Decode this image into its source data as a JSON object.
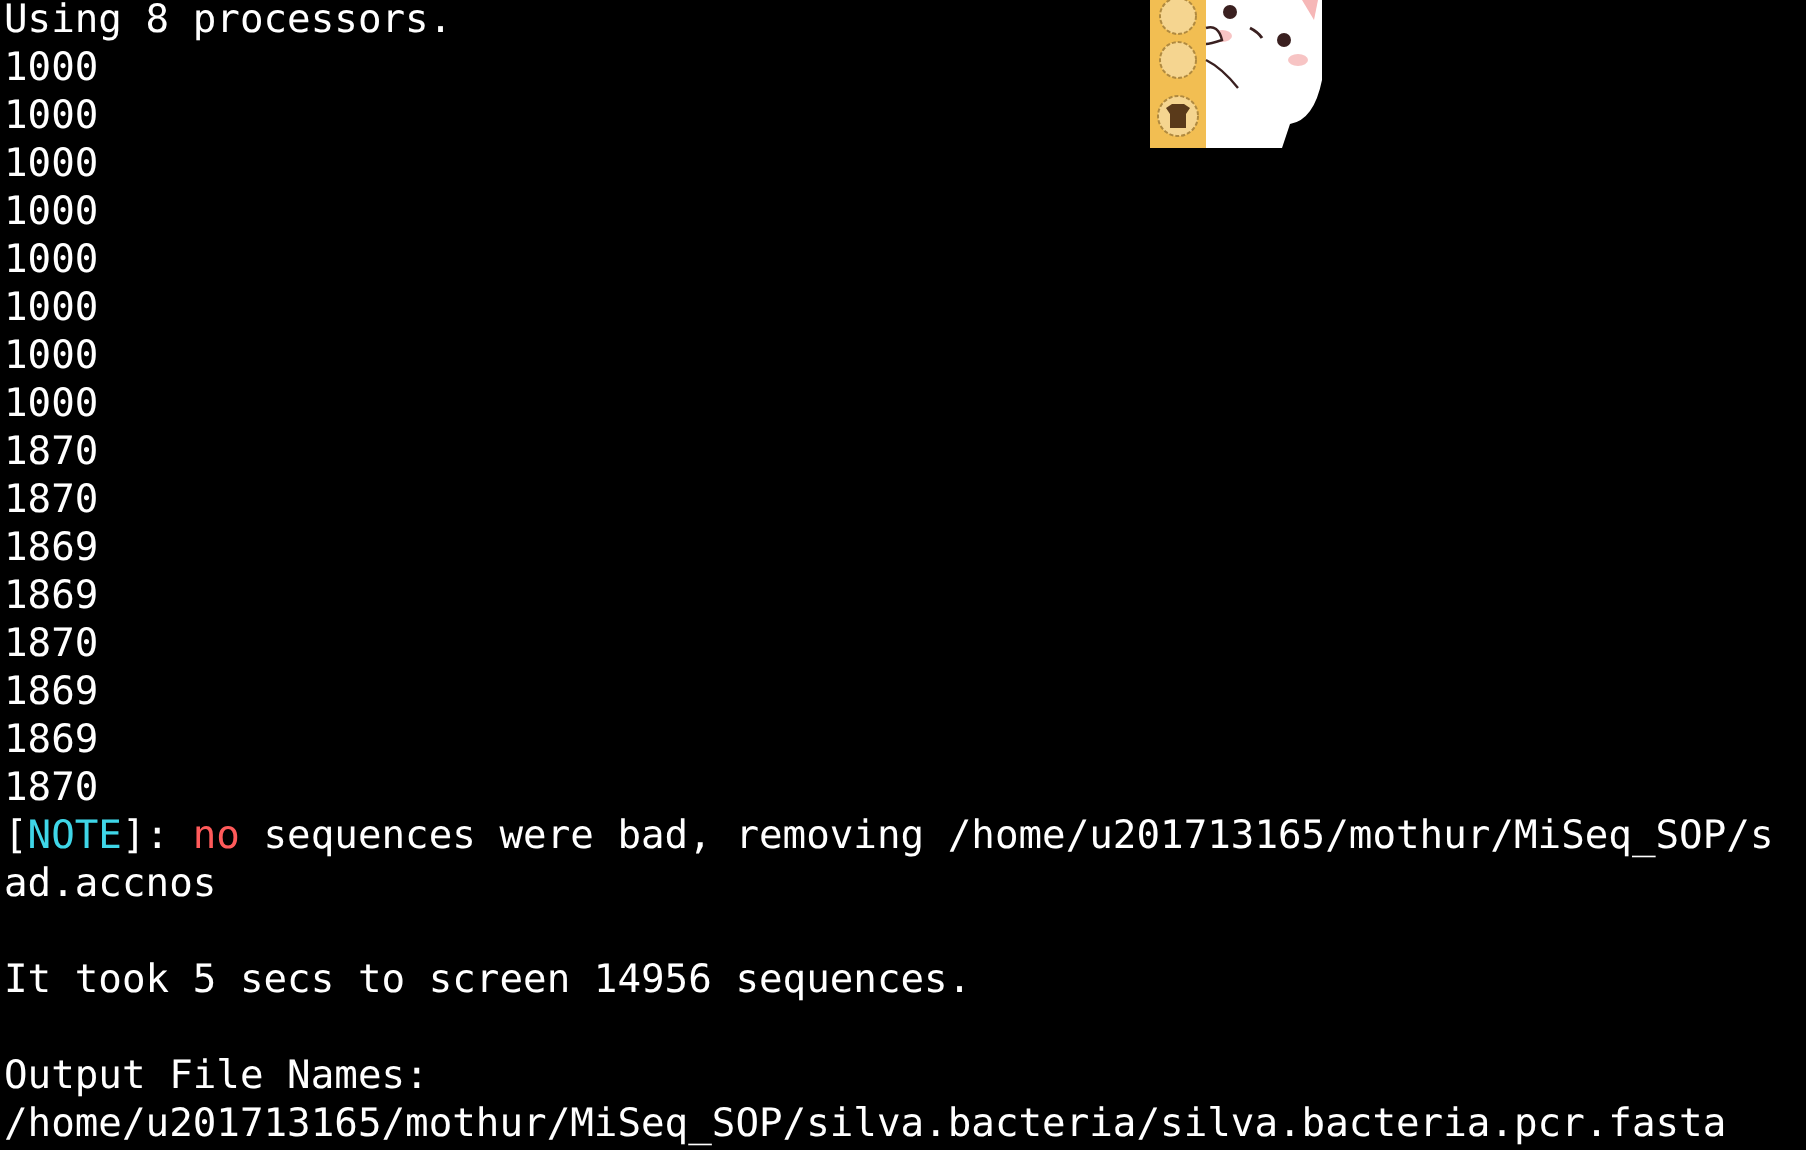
{
  "terminal": {
    "lines": [
      {
        "kind": "text",
        "segments": [
          {
            "text": "Using 8 processors.",
            "color": "#ffffff"
          }
        ]
      },
      {
        "kind": "text",
        "segments": [
          {
            "text": "1000",
            "color": "#ffffff"
          }
        ]
      },
      {
        "kind": "text",
        "segments": [
          {
            "text": "1000",
            "color": "#ffffff"
          }
        ]
      },
      {
        "kind": "text",
        "segments": [
          {
            "text": "1000",
            "color": "#ffffff"
          }
        ]
      },
      {
        "kind": "text",
        "segments": [
          {
            "text": "1000",
            "color": "#ffffff"
          }
        ]
      },
      {
        "kind": "text",
        "segments": [
          {
            "text": "1000",
            "color": "#ffffff"
          }
        ]
      },
      {
        "kind": "text",
        "segments": [
          {
            "text": "1000",
            "color": "#ffffff"
          }
        ]
      },
      {
        "kind": "text",
        "segments": [
          {
            "text": "1000",
            "color": "#ffffff"
          }
        ]
      },
      {
        "kind": "text",
        "segments": [
          {
            "text": "1000",
            "color": "#ffffff"
          }
        ]
      },
      {
        "kind": "text",
        "segments": [
          {
            "text": "1870",
            "color": "#ffffff"
          }
        ]
      },
      {
        "kind": "text",
        "segments": [
          {
            "text": "1870",
            "color": "#ffffff"
          }
        ]
      },
      {
        "kind": "text",
        "segments": [
          {
            "text": "1869",
            "color": "#ffffff"
          }
        ]
      },
      {
        "kind": "text",
        "segments": [
          {
            "text": "1869",
            "color": "#ffffff"
          }
        ]
      },
      {
        "kind": "text",
        "segments": [
          {
            "text": "1870",
            "color": "#ffffff"
          }
        ]
      },
      {
        "kind": "text",
        "segments": [
          {
            "text": "1869",
            "color": "#ffffff"
          }
        ]
      },
      {
        "kind": "text",
        "segments": [
          {
            "text": "1869",
            "color": "#ffffff"
          }
        ]
      },
      {
        "kind": "text",
        "segments": [
          {
            "text": "1870",
            "color": "#ffffff"
          }
        ]
      },
      {
        "kind": "text",
        "segments": [
          {
            "text": "[",
            "color": "#ffffff"
          },
          {
            "text": "NOTE",
            "color": "#3fd6e8"
          },
          {
            "text": "]: ",
            "color": "#ffffff"
          },
          {
            "text": "no",
            "color": "#ff5a5a"
          },
          {
            "text": " sequences were bad, removing /home/u201713165/mothur/MiSeq_SOP/s",
            "color": "#ffffff"
          }
        ]
      },
      {
        "kind": "text",
        "segments": [
          {
            "text": "ad.accnos",
            "color": "#ffffff"
          }
        ]
      },
      {
        "kind": "blank"
      },
      {
        "kind": "text",
        "segments": [
          {
            "text": "It took 5 secs to screen 14956 sequences.",
            "color": "#ffffff"
          }
        ]
      },
      {
        "kind": "blank"
      },
      {
        "kind": "text",
        "segments": [
          {
            "text": "Output File Names:",
            "color": "#ffffff"
          }
        ]
      },
      {
        "kind": "text",
        "segments": [
          {
            "text": "/home/u201713165/mothur/MiSeq_SOP/silva.bacteria/silva.bacteria.pcr.fasta",
            "color": "#ffffff"
          }
        ]
      }
    ]
  }
}
